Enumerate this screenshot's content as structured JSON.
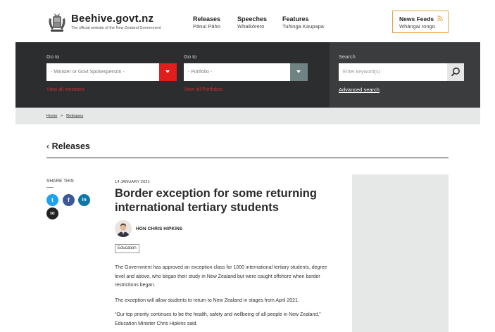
{
  "header": {
    "site_name": "Beehive.govt.nz",
    "site_tagline": "The official website of the New Zealand Government",
    "nav": [
      {
        "label": "Releases",
        "label_mi": "Pānui Pāho"
      },
      {
        "label": "Speeches",
        "label_mi": "Whaikōrero"
      },
      {
        "label": "Features",
        "label_mi": "Tuhinga Kaupapa"
      }
    ],
    "news_feeds": {
      "label": "News Feeds",
      "label_mi": "Whāngai rongo"
    }
  },
  "search_band": {
    "minister": {
      "label": "Go to",
      "placeholder": "- Minister or Govt Spokesperson -",
      "link": "View all ministers"
    },
    "portfolio": {
      "label": "Go to",
      "placeholder": "- Portfolio -",
      "link": "View all Portfolios"
    },
    "search": {
      "label": "Search",
      "placeholder": "Enter keyword(s)",
      "advanced": "Advanced search"
    },
    "colors": {
      "minister_button": "#e01e1e",
      "portfolio_button": "#6f8284"
    }
  },
  "breadcrumb": {
    "home": "Home",
    "separator": ">",
    "current": "Releases"
  },
  "page": {
    "back_title": "Releases"
  },
  "share": {
    "label": "SHARE THIS",
    "buttons": [
      {
        "icon": "twitter-icon",
        "glyph": "t",
        "color": "#1da1f2"
      },
      {
        "icon": "facebook-icon",
        "glyph": "f",
        "color": "#3b5998"
      },
      {
        "icon": "linkedin-icon",
        "glyph": "in",
        "color": "#0e76a8"
      },
      {
        "icon": "email-icon",
        "glyph": "✉",
        "color": "#222222"
      }
    ]
  },
  "article": {
    "date": "14 JANUARY 2021",
    "title": "Border exception for some returning international tertiary students",
    "author": "HON CHRIS HIPKINS",
    "tag": "Education",
    "paragraphs": [
      "The Government has approved an exception class for 1000 international tertiary students, degree level and above, who began their study in New Zealand but were caught offshore when border restrictions began.",
      "The exception will allow students to return to New Zealand in stages from April 2021.",
      "“Our top priority continues to be the health, safety and wellbeing of all people in New Zealand,” Education Minister Chris Hipkins said."
    ]
  }
}
